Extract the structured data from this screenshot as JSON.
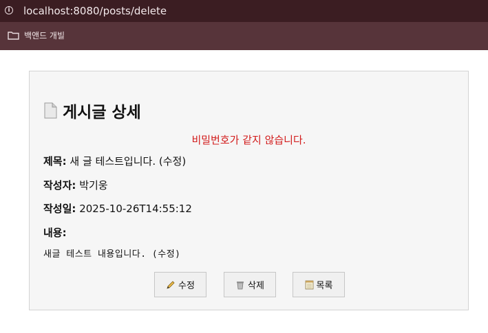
{
  "browser": {
    "url": "localhost:8080/posts/delete",
    "bookmark_label": "백앤드 개빌"
  },
  "page": {
    "title": "게시글 상세",
    "error": "비밀번호가 같지 않습니다.",
    "fields": {
      "subject_label": "제목:",
      "subject_value": "새 글 테스트입니다. (수정)",
      "author_label": "작성자:",
      "author_value": "박기웅",
      "date_label": "작성일:",
      "date_value": "2025-10-26T14:55:12",
      "content_label": "내용:",
      "content_value": "새글 테스트 내용입니다. (수정)"
    },
    "buttons": {
      "edit": "수정",
      "delete": "삭제",
      "list": "목록"
    }
  },
  "colors": {
    "urlbar": "#3b1d22",
    "bookmarks_bar": "#57343a",
    "error": "#d21a1a"
  },
  "icons": [
    "info-icon",
    "folder-icon",
    "document-icon",
    "pencil-icon",
    "trash-icon",
    "notepad-icon"
  ]
}
